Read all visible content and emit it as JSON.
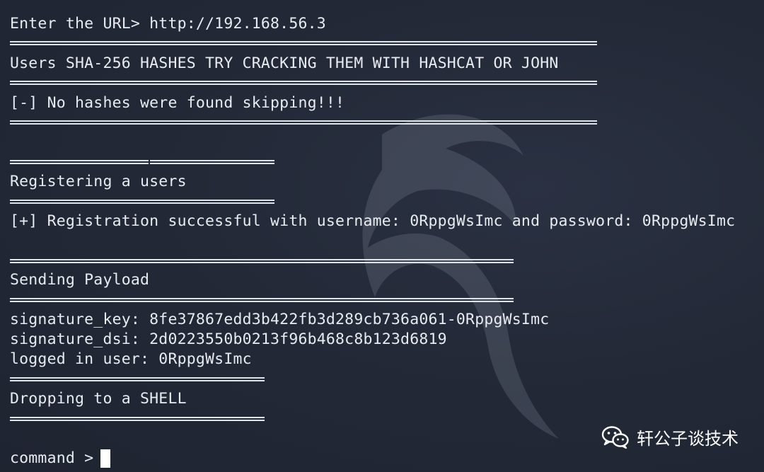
{
  "terminal": {
    "lines": {
      "url_prompt": "Enter the URL> http://192.168.56.3",
      "hashes_header": "Users SHA-256 HASHES TRY CRACKING THEM WITH HASHCAT OR JOHN",
      "no_hashes": "[-] No hashes were found skipping!!!",
      "registering": "Registering a users",
      "registration_result": "[+] Registration successful with username: 0RppgWsImc and password: 0RppgWsImc",
      "sending_payload": "Sending Payload",
      "signature_key": "signature_key: 8fe37867edd3b422fb3d289cb736a061-0RppgWsImc",
      "signature_dsi": "signature_dsi: 2d0223550b0213f96b468c8b123d6819",
      "logged_in": "logged in user: 0RppgWsImc",
      "dropping_shell": "Dropping to a SHELL",
      "command_prompt": "command > "
    }
  },
  "watermark": {
    "text": "轩公子谈技术",
    "icon": "wechat-icon"
  },
  "colors": {
    "background": "#222836",
    "text": "#e8ebf0"
  }
}
